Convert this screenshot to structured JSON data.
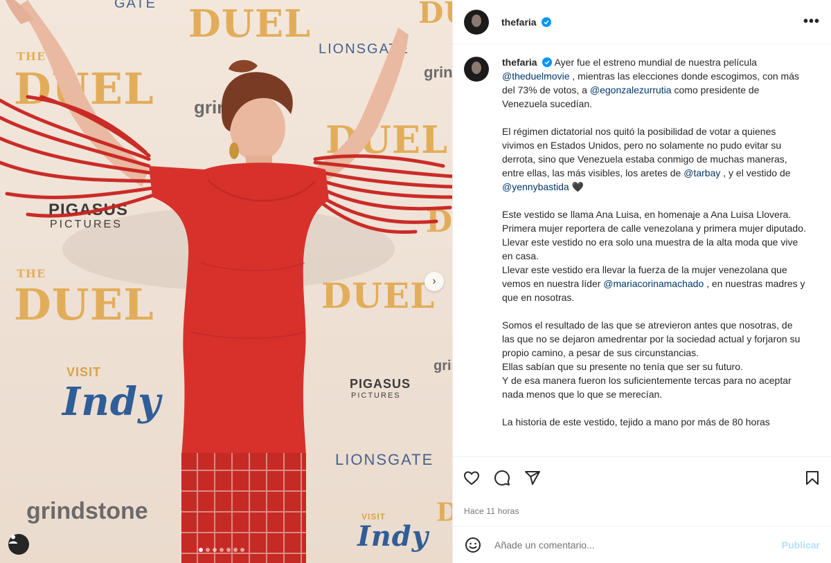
{
  "post": {
    "username": "thefaria",
    "more_label": "•••",
    "time": "Hace 11 horas"
  },
  "media": {
    "wall": {
      "duel_big": "DUEL",
      "the_small": "THE",
      "lionsgate": "LIONSGATE",
      "grindstone": "grindstone",
      "grind": "grind",
      "pigasus": "PIGASUS",
      "pictures": "PICTURES",
      "visit": "VISIT",
      "indy": "Indy",
      "gate": "GATE"
    },
    "carousel_count": 7,
    "carousel_active": 0
  },
  "caption": {
    "username": "thefaria",
    "p1_a": "Ayer fue el estreno mundial de nuestra película",
    "p1_link1": "@theduelmovie",
    "p1_b": ", mientras las elecciones donde escogimos, con más del 73% de votos, a",
    "p1_link2": "@egonzalezurrutia",
    "p1_c": "como presidente de Venezuela sucedían.",
    "p2_a": "El régimen dictatorial nos quitó la posibilidad de votar a quienes vivimos en Estados Unidos, pero no solamente no pudo evitar su derrota, sino que Venezuela estaba conmigo de muchas maneras, entre ellas, las más visibles, los aretes de",
    "p2_link1": "@tarbay",
    "p2_b": ", y el vestido de",
    "p2_link2": "@yennybastida",
    "p2_heart": "🖤",
    "p3_1": "Este vestido se llama Ana Luisa, en homenaje a Ana Luisa Llovera. Primera mujer reportera de calle venezolana y primera mujer diputado.",
    "p3_2": "Llevar este vestido no era solo una muestra de la alta moda que vive en casa.",
    "p3_3a": "Llevar este vestido era llevar la fuerza de la mujer venezolana que vemos en nuestra líder",
    "p3_link": "@mariacorinamachado",
    "p3_3b": ", en nuestras madres y que en nosotras.",
    "p4_1": "Somos el resultado de las que se atrevieron antes que nosotras, de las que no se dejaron amedrentar por la sociedad actual y forjaron su propio camino, a pesar de sus circunstancias.",
    "p4_2": "Ellas sabían que su presente no tenía que ser su futuro.",
    "p4_3": "Y de esa manera fueron los suficientemente tercas para no aceptar nada menos que lo que se merecían.",
    "p5": "La historia de este vestido, tejido a mano por más de 80 horas"
  },
  "comment": {
    "placeholder": "Añade un comentario...",
    "post_label": "Publicar"
  },
  "colors": {
    "link": "#00376b",
    "verified": "#0095f6",
    "dress": "#d8312c",
    "duel_gold": "#e2ad5a"
  }
}
